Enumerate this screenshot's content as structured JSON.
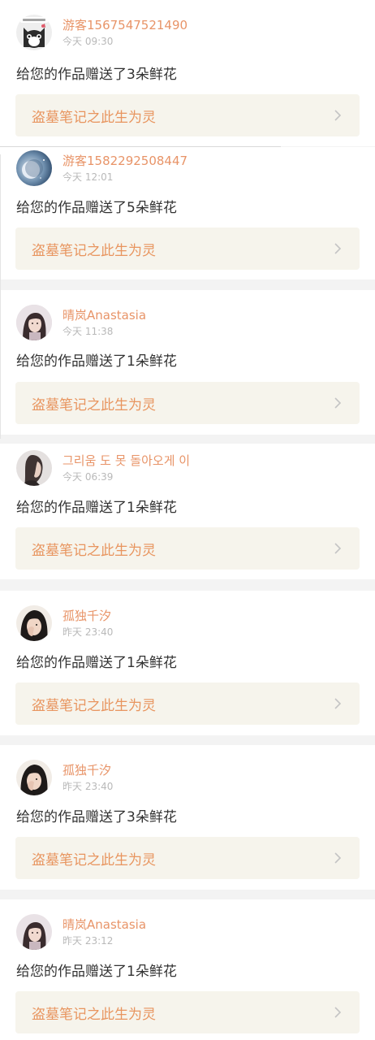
{
  "feed": {
    "items": [
      {
        "username": "游客1567547521490",
        "time": "今天 09:30",
        "message": "给您的作品赠送了3朵鲜花",
        "work_title": "盗墓笔记之此生为灵",
        "avatar": "cat-avatar"
      },
      {
        "username": "游客1582292508447",
        "time": "今天 12:01",
        "message": "给您的作品赠送了5朵鲜花",
        "work_title": "盗墓笔记之此生为灵",
        "avatar": "moon-avatar"
      },
      {
        "username": "晴岚Anastasia",
        "time": "今天 11:38",
        "message": "给您的作品赠送了1朵鲜花",
        "work_title": "盗墓笔记之此生为灵",
        "avatar": "girl-avatar"
      },
      {
        "username": "그리움 도 못 돌아오게 이",
        "time": "今天 06:39",
        "message": "给您的作品赠送了1朵鲜花",
        "work_title": "盗墓笔记之此生为灵",
        "avatar": "profile-avatar"
      },
      {
        "username": "孤独千汐",
        "time": "昨天 23:40",
        "message": "给您的作品赠送了1朵鲜花",
        "work_title": "盗墓笔记之此生为灵",
        "avatar": "face-avatar"
      },
      {
        "username": "孤独千汐",
        "time": "昨天 23:40",
        "message": "给您的作品赠送了3朵鲜花",
        "work_title": "盗墓笔记之此生为灵",
        "avatar": "face-avatar"
      },
      {
        "username": "晴岚Anastasia",
        "time": "昨天 23:12",
        "message": "给您的作品赠送了1朵鲜花",
        "work_title": "盗墓笔记之此生为灵",
        "avatar": "girl-avatar"
      }
    ]
  },
  "colors": {
    "username": "#e89468",
    "time": "#b9b9b9",
    "message": "#333333",
    "link_bg": "#f6f4ec",
    "link_text": "#e8955f",
    "page_bg": "#f3f3f3"
  },
  "icons": {
    "chevron": "chevron-right-icon"
  }
}
